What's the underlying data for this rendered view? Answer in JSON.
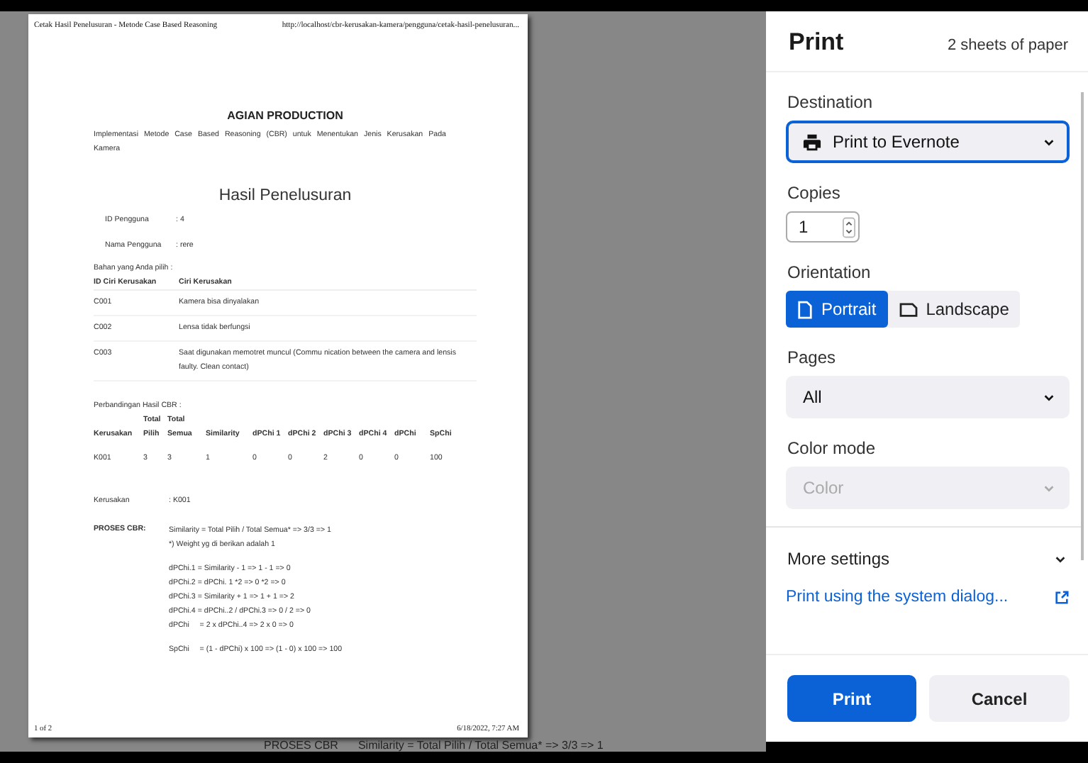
{
  "preview": {
    "header_title": "Cetak Hasil Penelusuran - Metode Case Based Reasoning",
    "header_url": "http://localhost/cbr-kerusakan-kamera/pengguna/cetak-hasil-penelusuran...",
    "company": "AGIAN PRODUCTION",
    "subtitle": "Implementasi Metode Case Based Reasoning (CBR) untuk Menentukan Jenis Kerusakan Pada Kamera",
    "heading": "Hasil Penelusuran",
    "user_fields": [
      {
        "label": "ID Pengguna",
        "value": ": 4"
      },
      {
        "label": "Nama Pengguna",
        "value": ": rere"
      }
    ],
    "selection_label": "Bahan yang Anda pilih :",
    "criteria_table": {
      "columns": [
        "ID Ciri Kerusakan",
        "Ciri Kerusakan"
      ],
      "rows": [
        [
          "C001",
          "Kamera bisa dinyalakan"
        ],
        [
          "C002",
          "Lensa tidak berfungsi"
        ],
        [
          "C003",
          "Saat digunakan memotret muncul (Commu nication between the camera and lensis faulty. Clean contact)"
        ]
      ]
    },
    "comparison_label": "Perbandingan Hasil CBR :",
    "comparison_table": {
      "columns": [
        "Kerusakan",
        "Total Pilih",
        "Total Semua",
        "Similarity",
        "dPChi 1",
        "dPChi 2",
        "dPChi 3",
        "dPChi 4",
        "dPChi",
        "SpChi"
      ],
      "rows": [
        [
          "K001",
          "3",
          "3",
          "1",
          "0",
          "0",
          "2",
          "0",
          "0",
          "100"
        ]
      ]
    },
    "result": {
      "label": "Kerusakan",
      "value": ": K001"
    },
    "process": {
      "label": "PROSES CBR:",
      "groups": [
        [
          "Similarity = Total Pilih / Total Semua* => 3/3 => 1",
          "*) Weight yg di berikan adalah 1"
        ],
        [
          "dPChi.1 = Similarity - 1 => 1 - 1 => 0",
          "dPChi.2 = dPChi. 1 *2 => 0 *2 => 0",
          "dPChi.3 = Similarity + 1 => 1 + 1 => 2",
          "dPChi.4 = dPChi..2 / dPChi.3 => 0 / 2 => 0",
          "dPChi     = 2 x dPChi..4 => 2 x 0 => 0"
        ],
        [
          "SpChi     = (1 - dPChi) x 100 => (1 - 0) x 100 => 100"
        ]
      ]
    },
    "footer_page": "1 of 2",
    "footer_date": "6/18/2022, 7:27 AM"
  },
  "behind_text": [
    "PROSES CBR",
    "Similarity = Total Pilih / Total Semua* => 3/3 => 1"
  ],
  "print_panel": {
    "title": "Print",
    "sheets": "2 sheets of paper",
    "fields": [
      {
        "kind": "select",
        "label": "Destination",
        "value": "Print to Evernote",
        "device_icon": true,
        "focused": true,
        "disabled": false
      },
      {
        "kind": "number",
        "label": "Copies",
        "value": "1"
      },
      {
        "kind": "segmented",
        "label": "Orientation",
        "options": [
          {
            "label": "Portrait",
            "selected": true
          },
          {
            "label": "Landscape",
            "selected": false
          }
        ]
      },
      {
        "kind": "select",
        "label": "Pages",
        "value": "All",
        "device_icon": false,
        "focused": false,
        "disabled": false
      },
      {
        "kind": "select",
        "label": "Color mode",
        "value": "Color",
        "device_icon": false,
        "focused": false,
        "disabled": true
      }
    ],
    "more_settings": "More settings",
    "system_dialog_link": "Print using the system dialog...",
    "buttons": [
      {
        "kind": "primary",
        "label": "Print"
      },
      {
        "kind": "secondary",
        "label": "Cancel"
      }
    ]
  }
}
